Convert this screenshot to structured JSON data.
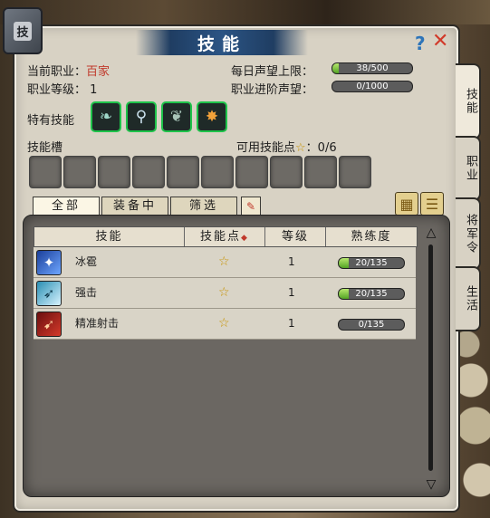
{
  "window": {
    "title": "技能",
    "book_glyph": "技",
    "help_icon": "?",
    "close_icon": "✕"
  },
  "info": {
    "current_job_label": "当前职业：",
    "current_job_value": "百家",
    "job_level_label": "职业等级：",
    "job_level_value": "1",
    "daily_rep_label": "每日声望上限：",
    "daily_rep_value": "38/500",
    "daily_rep_progress": 0.076,
    "advance_rep_label": "职业进阶声望：",
    "advance_rep_value": "0/1000",
    "advance_rep_progress": 0.0
  },
  "special_skills_label": "特有技能",
  "skill_slot_label": "技能槽",
  "skill_points_label": "可用技能点",
  "skill_points_value": "：0/6",
  "filter_tabs": [
    "全部",
    "装备中",
    "筛选"
  ],
  "table": {
    "headers": [
      "技能",
      "技能点",
      "等级",
      "熟练度"
    ],
    "rows": [
      {
        "name": "冰雹",
        "level": "1",
        "proficiency": "20/135",
        "progress": 0.148
      },
      {
        "name": "强击",
        "level": "1",
        "proficiency": "20/135",
        "progress": 0.148
      },
      {
        "name": "精准射击",
        "level": "1",
        "proficiency": "0/135",
        "progress": 0.0
      }
    ]
  },
  "side_tabs": [
    "技能",
    "职业",
    "将军令",
    "生活"
  ],
  "colors": {
    "accent_red": "#c0392b",
    "progress_green": "#52a323",
    "special_border": "#1ec34a"
  }
}
